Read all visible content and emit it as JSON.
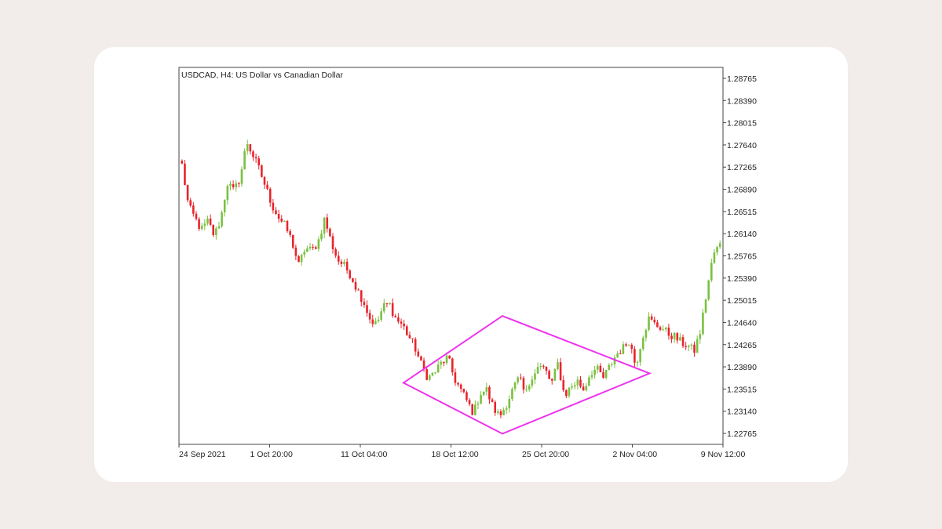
{
  "chart_data": {
    "type": "candlestick",
    "title": "USDCAD, H4:  US Dollar vs Canadian Dollar",
    "symbol": "USDCAD",
    "timeframe": "H4",
    "ylim": [
      1.2258,
      1.2895
    ],
    "y_ticks": [
      "1.28765",
      "1.28390",
      "1.28015",
      "1.27640",
      "1.27265",
      "1.26890",
      "1.26515",
      "1.26140",
      "1.25765",
      "1.25390",
      "1.25015",
      "1.24640",
      "1.24265",
      "1.23890",
      "1.23515",
      "1.23140",
      "1.22765"
    ],
    "x_ticks": [
      "24 Sep 2021",
      "1 Oct 20:00",
      "11 Oct 04:00",
      "18 Oct 12:00",
      "25 Oct 20:00",
      "2 Nov 04:00",
      "9 Nov 12:00"
    ],
    "grid": false,
    "colors": {
      "bull": "#7ac142",
      "bear": "#e8242c",
      "pattern": "#ee33ee",
      "axis": "#444444"
    },
    "close_path": [
      1.273,
      1.266,
      1.264,
      1.262,
      1.2635,
      1.261,
      1.264,
      1.27,
      1.2685,
      1.271,
      1.277,
      1.2745,
      1.272,
      1.269,
      1.266,
      1.264,
      1.2625,
      1.26,
      1.256,
      1.259,
      1.2585,
      1.26,
      1.264,
      1.26,
      1.257,
      1.256,
      1.2545,
      1.252,
      1.25,
      1.247,
      1.246,
      1.249,
      1.2495,
      1.247,
      1.246,
      1.244,
      1.242,
      1.239,
      1.237,
      1.238,
      1.2395,
      1.2405,
      1.237,
      1.235,
      1.233,
      1.231,
      1.2345,
      1.235,
      1.232,
      1.2305,
      1.2325,
      1.235,
      1.237,
      1.234,
      1.2375,
      1.239,
      1.2385,
      1.236,
      1.2395,
      1.234,
      1.2355,
      1.2365,
      1.235,
      1.238,
      1.2385,
      1.237,
      1.239,
      1.241,
      1.242,
      1.2435,
      1.239,
      1.244,
      1.247,
      1.246,
      1.2455,
      1.2445,
      1.244,
      1.243,
      1.2425,
      1.2415,
      1.245,
      1.252,
      1.258,
      1.2595
    ],
    "diamond_pattern": {
      "left": {
        "x": "11 Oct 04:00",
        "y": 1.2362
      },
      "top": {
        "x": "25 Oct 20:00",
        "y": 1.2475
      },
      "right": {
        "x": "2 Nov 04:00",
        "y": 1.2378
      },
      "bottom": {
        "x": "25 Oct 20:00",
        "y": 1.2276
      }
    }
  }
}
